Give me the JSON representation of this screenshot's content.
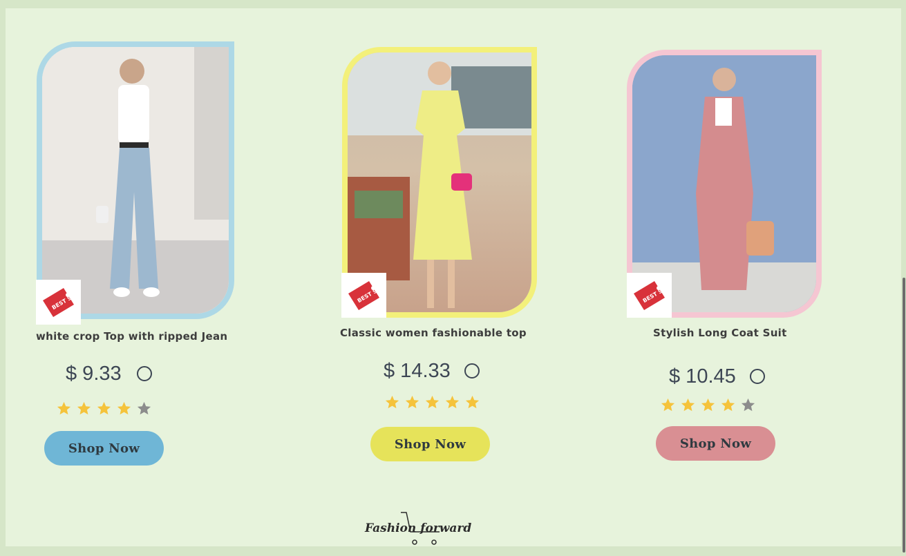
{
  "products": [
    {
      "title": "white crop Top  with ripped Jean",
      "price": "$ 9.33",
      "rating": 4,
      "max_rating": 5,
      "button_label": "Shop Now",
      "accent": "#add8e6",
      "button_color": "#6fb6d6",
      "badge_text": "BEST SELLER"
    },
    {
      "title": "Classic women fashionable top",
      "price": "$ 14.33",
      "rating": 5,
      "max_rating": 5,
      "button_label": "Shop Now",
      "accent": "#f3f07a",
      "button_color": "#e6e35a",
      "badge_text": "BEST SELLER"
    },
    {
      "title": "Stylish Long Coat Suit",
      "price": "$ 10.45",
      "rating": 4,
      "max_rating": 5,
      "button_label": "Shop Now",
      "accent": "#f5c6d2",
      "button_color": "#d98f93",
      "badge_text": "BEST SELLER"
    }
  ],
  "footer": {
    "brand": "Fashion forward"
  },
  "colors": {
    "page_bg": "#e7f3dc",
    "star_filled": "#f5c33b",
    "star_empty": "#8c8c8c"
  }
}
